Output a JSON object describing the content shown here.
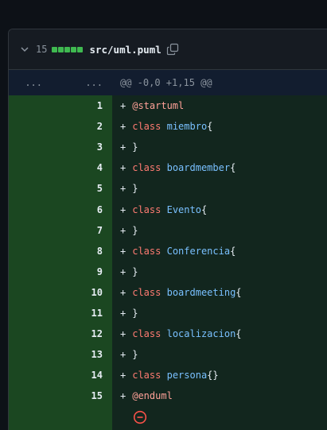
{
  "header": {
    "line_count": "15",
    "file_path": "src/uml.puml",
    "icons": [
      "chevron-down-icon",
      "copy-icon"
    ],
    "diffstat_color": "#3fb950"
  },
  "hunk": {
    "old_dots": "...",
    "new_dots": "...",
    "text": "@@ -0,0 +1,15 @@"
  },
  "lines": [
    {
      "n": "1",
      "parts": [
        {
          "t": "@startuml",
          "c": "at"
        }
      ]
    },
    {
      "n": "2",
      "parts": [
        {
          "t": "class ",
          "c": "kw"
        },
        {
          "t": "miembro",
          "c": "name"
        },
        {
          "t": "{",
          "c": "br"
        }
      ]
    },
    {
      "n": "3",
      "parts": [
        {
          "t": "}",
          "c": "br"
        }
      ]
    },
    {
      "n": "4",
      "parts": [
        {
          "t": "class ",
          "c": "kw"
        },
        {
          "t": "boardmember",
          "c": "name"
        },
        {
          "t": "{",
          "c": "br"
        }
      ]
    },
    {
      "n": "5",
      "parts": [
        {
          "t": "}",
          "c": "br"
        }
      ]
    },
    {
      "n": "6",
      "parts": [
        {
          "t": "class ",
          "c": "kw"
        },
        {
          "t": "Evento",
          "c": "name"
        },
        {
          "t": "{",
          "c": "br"
        }
      ]
    },
    {
      "n": "7",
      "parts": [
        {
          "t": "}",
          "c": "br"
        }
      ]
    },
    {
      "n": "8",
      "parts": [
        {
          "t": "class ",
          "c": "kw"
        },
        {
          "t": "Conferencia",
          "c": "name"
        },
        {
          "t": "{",
          "c": "br"
        }
      ]
    },
    {
      "n": "9",
      "parts": [
        {
          "t": "}",
          "c": "br"
        }
      ]
    },
    {
      "n": "10",
      "parts": [
        {
          "t": "class ",
          "c": "kw"
        },
        {
          "t": "boardmeeting",
          "c": "name"
        },
        {
          "t": "{",
          "c": "br"
        }
      ]
    },
    {
      "n": "11",
      "parts": [
        {
          "t": "}",
          "c": "br"
        }
      ]
    },
    {
      "n": "12",
      "parts": [
        {
          "t": "class ",
          "c": "kw"
        },
        {
          "t": "localizacion",
          "c": "name"
        },
        {
          "t": "{",
          "c": "br"
        }
      ]
    },
    {
      "n": "13",
      "parts": [
        {
          "t": "}",
          "c": "br"
        }
      ]
    },
    {
      "n": "14",
      "parts": [
        {
          "t": "class ",
          "c": "kw"
        },
        {
          "t": "persona",
          "c": "name"
        },
        {
          "t": "{}",
          "c": "br"
        }
      ]
    },
    {
      "n": "15",
      "parts": [
        {
          "t": "@enduml",
          "c": "at"
        }
      ]
    }
  ],
  "plus_sign": "+",
  "tail_icon": "minus-circle-icon"
}
